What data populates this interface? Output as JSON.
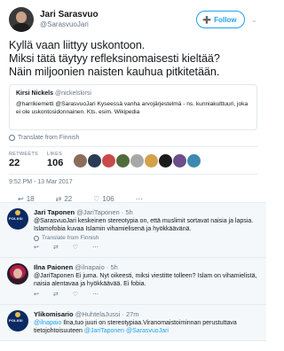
{
  "author": {
    "name": "Jari Sarasvuo",
    "handle": "@SarasvuoJari",
    "follow_label": "Follow"
  },
  "tweet": {
    "line1": "Kyllä vaan liittyy uskontoon.",
    "line2": "Miksi tätä täytyy refleksinomaisesti kieltää?",
    "line3": "Näin miljoonien naisten kauhua pitkitetään.",
    "translate_label": "Translate from Finnish",
    "timestamp": "9:52 PM - 13 Mar 2017"
  },
  "quote": {
    "name": "Kirsi Nickels",
    "handle": "@nickelskirsi",
    "text": "@harrikiemetti @SarasvuoJari Kyseessä vanha arvojärjestelmä - ns. kunniakulttuuri, joka ei ole uskontosidonnainen. Kts. esim. Wikipedia"
  },
  "stats": {
    "retweets_label": "RETWEETS",
    "retweets": "22",
    "likes_label": "LIKES",
    "likes": "106",
    "liker_colors": [
      "#8a6d5a",
      "#2b3a55",
      "#c94a4a",
      "#4f6d3a",
      "#a8a8a8",
      "#d2a24c",
      "#1b1b1b",
      "#6b4e8a",
      "#3d8ab0"
    ]
  },
  "actions": {
    "reply_icon": "reply-icon",
    "reply_count": "18",
    "retweet_icon": "retweet-icon",
    "retweet_count": "22",
    "like_icon": "heart-icon",
    "like_count": "106",
    "more_icon": "more-icon"
  },
  "replies": [
    {
      "name": "Jari Taponen",
      "handle": "@JariTaponen",
      "time": "5h",
      "text": "@SarasvuoJari keskeinen stereotypia on, että muslimit sortavat naisia ja lapsia. Islamofobia kuvaa Islamin vihamielisenä ja hyökkäävänä.",
      "translate_label": "Translate from Finnish"
    },
    {
      "name": "Ilna Paionen",
      "handle": "@ilnapaio",
      "time": "5h",
      "text": "@JariTaponen Ei juma. Nyt oikeesti, miksi viestitte tolleen? Islam on vihamielistä, naisia alentavaa ja hyökkäävää. Ei fobia.",
      "mention": "@SarasvuoJari"
    },
    {
      "name": "Ylikomisario",
      "handle": "@HuhtelaJussi",
      "time": "27m",
      "mention_lead": "@ilnapaio",
      "text": " Ilna,tuo juuri on stereotypiaa.Viranomaistoiminnan perustuttava tietojohtoisuuteen",
      "mention_tail": " @JariTaponen @SarasvuoJari"
    }
  ]
}
